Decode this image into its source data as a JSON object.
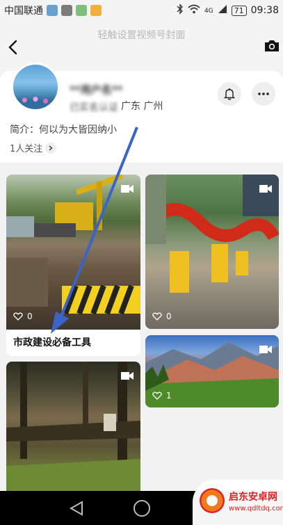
{
  "status_bar": {
    "carrier": "中国联通",
    "network": "4G",
    "battery": "71",
    "time": "09:38"
  },
  "header": {
    "title": "轻触设置视频号封面"
  },
  "profile": {
    "username": "**用户名**",
    "meta_blurred": "已实名认证",
    "location": "广东 广州",
    "bio": "简介：何以为大皆因纳小",
    "follow": "1人关注"
  },
  "posts": [
    {
      "likes": "0",
      "caption": "市政建设必备工具"
    },
    {
      "likes": "0",
      "caption": ""
    },
    {
      "likes": "1",
      "caption": ""
    },
    {
      "likes": "",
      "caption": ""
    }
  ],
  "watermark": {
    "title": "启东安卓网",
    "url": "www.qdltdq.com"
  },
  "colors": {
    "accent_arrow": "#3a64c8",
    "watermark_red": "#e02020"
  }
}
